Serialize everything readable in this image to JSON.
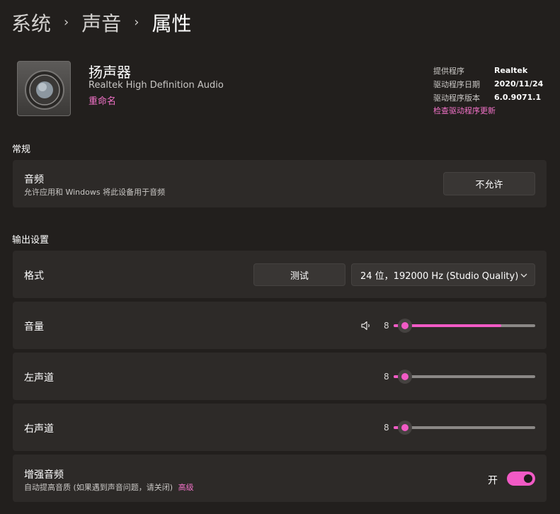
{
  "breadcrumb": {
    "items": [
      "系统",
      "声音",
      "属性"
    ]
  },
  "device": {
    "name": "扬声器",
    "description": "Realtek High Definition Audio",
    "rename": "重命名"
  },
  "driver": {
    "provider_label": "提供程序",
    "provider": "Realtek",
    "date_label": "驱动程序日期",
    "date": "2020/11/24",
    "version_label": "驱动程序版本",
    "version": "6.0.9071.1",
    "update_link": "检查驱动程序更新"
  },
  "general": {
    "title": "常规",
    "audio_title": "音频",
    "audio_sub": "允许应用和 Windows 将此设备用于音频",
    "audio_button": "不允许"
  },
  "output": {
    "title": "输出设置",
    "format_label": "格式",
    "test_button": "测试",
    "format_value": "24 位，192000 Hz (Studio Quality)",
    "volume_label": "音量",
    "volume_value": "8",
    "volume_level": 8,
    "volume_fill_percent": 76,
    "left_label": "左声道",
    "left_value": "8",
    "left_level": 8,
    "right_label": "右声道",
    "right_value": "8",
    "right_level": 8,
    "enhance_title": "增强音频",
    "enhance_sub": "自动提高音质 (如果遇到声音问题，请关闭)",
    "enhance_advanced": "高级",
    "enhance_state": "开"
  },
  "colors": {
    "accent": "#f15ac5",
    "link": "#f272c8",
    "background": "#221f1d",
    "card": "#2d2a28"
  },
  "icons": {
    "device": "speaker-icon",
    "volume": "volume-icon",
    "dropdown": "chevron-down-icon",
    "separator": "chevron-right-icon"
  }
}
